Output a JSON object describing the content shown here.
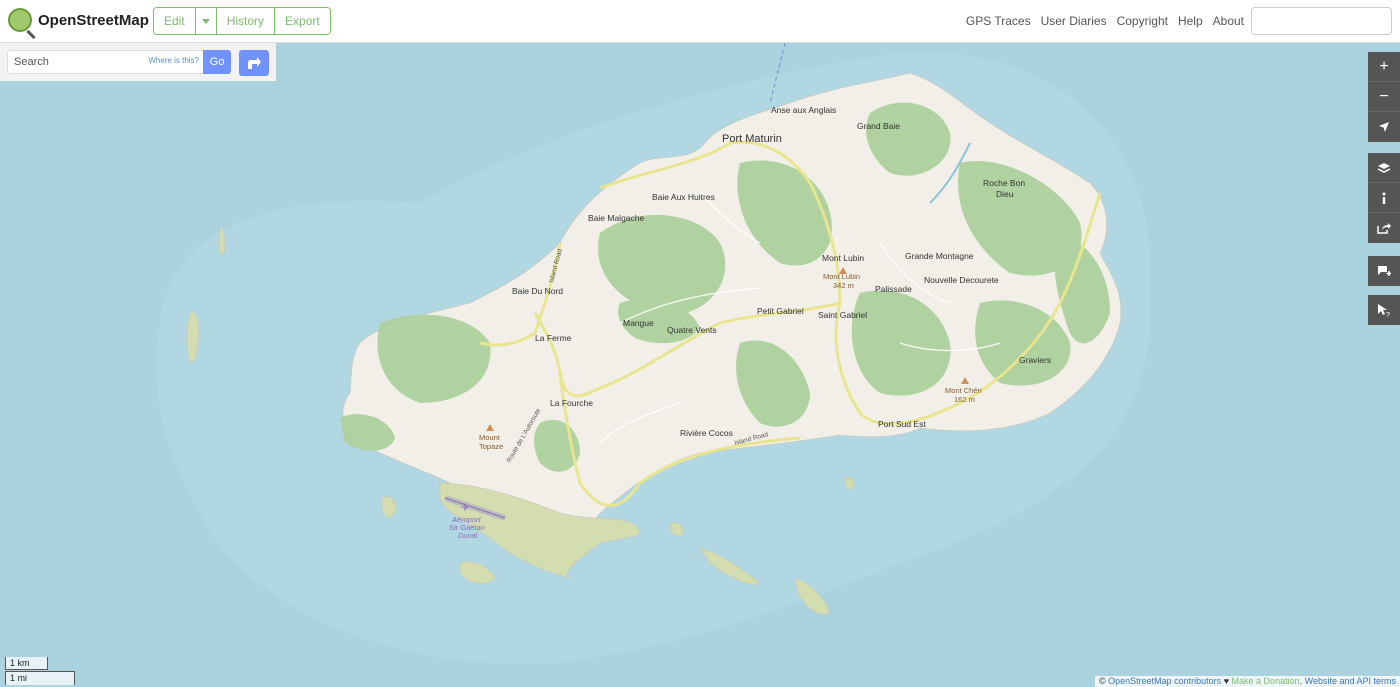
{
  "header": {
    "app_name": "OpenStreetMap",
    "edit_label": "Edit",
    "history_label": "History",
    "export_label": "Export",
    "nav": [
      "GPS Traces",
      "User Diaries",
      "Copyright",
      "Help",
      "About"
    ]
  },
  "search": {
    "placeholder": "Search",
    "where_link": "Where is this?",
    "go_label": "Go"
  },
  "map": {
    "places": {
      "port_maturin": "Port Maturin",
      "anse_aux_anglais": "Anse aux Anglais",
      "grand_baie": "Grand Baie",
      "roche_bon": "Roche Bon",
      "dieu": "Dieu",
      "baie_aux_huitres": "Baie Aux Huitres",
      "baie_malgache": "Baie Malgache",
      "mont_lubin_town": "Mont Lubin",
      "mont_lubin_peak": "Mont Lubin",
      "mont_lubin_ele": "342 m",
      "grande_montagne": "Grande Montagne",
      "nouvelle_decourete": "Nouvelle Decourete",
      "palissade": "Palissade",
      "baie_du_nord": "Baie Du Nord",
      "petit_gabriel": "Petit Gabriel",
      "saint_gabriel": "Saint Gabriel",
      "mangue": "Mangue",
      "quatre_vents": "Quatre Vents",
      "la_ferme": "La Ferme",
      "graviers": "Graviers",
      "mont_cheri": "Mont Chéri",
      "mont_cheri_ele": "162 m",
      "la_fourche": "La Fourche",
      "port_sud_est": "Port Sud Est",
      "mount_topaze_1": "Mount",
      "mount_topaze_2": "Topaze",
      "riviere_cocos": "Rivière Cocos",
      "airport_1": "Aéroport",
      "airport_2": "Sir Gaëtan",
      "airport_3": "Duval"
    },
    "roads": {
      "island_road_nw": "Island Road",
      "island_road_s": "Island Road",
      "route_autoroute": "Route de L'Autoroute"
    }
  },
  "controls": {
    "zoom_in": "+",
    "zoom_out": "−"
  },
  "scale": {
    "km": "1 km",
    "mi": "1 mi"
  },
  "attribution": {
    "prefix": "©",
    "osm": "OpenStreetMap contributors",
    "heart": "♥",
    "donate": "Make a Donation",
    "terms": "Website and API terms"
  },
  "colors": {
    "water": "#aad3df",
    "land": "#f2efe9",
    "forest": "#add19e",
    "scrub": "#c8d7ab",
    "road": "#f7fabf",
    "brand": "#7ebc6f",
    "button": "#7092ff"
  }
}
